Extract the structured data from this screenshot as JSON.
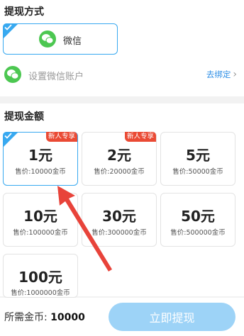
{
  "withdraw_method": {
    "title": "提现方式",
    "selected_option": {
      "label": "微信",
      "icon": "wechat-icon"
    },
    "setup_label": "设置微信账户",
    "bind_link": "去绑定"
  },
  "withdraw_amount": {
    "title": "提现金额",
    "options": [
      {
        "amount": "1元",
        "price": "售价:10000金币",
        "badge": "新人专享",
        "selected": true
      },
      {
        "amount": "2元",
        "price": "售价:20000金币",
        "badge": "新人专享",
        "selected": false
      },
      {
        "amount": "5元",
        "price": "售价:50000金币",
        "badge": "",
        "selected": false
      },
      {
        "amount": "10元",
        "price": "售价:100000金币",
        "badge": "",
        "selected": false
      },
      {
        "amount": "30元",
        "price": "售价:300000金币",
        "badge": "",
        "selected": false
      },
      {
        "amount": "50元",
        "price": "售价:500000金币",
        "badge": "",
        "selected": false
      },
      {
        "amount": "100元",
        "price": "售价:1000000金币",
        "badge": "",
        "selected": false
      }
    ]
  },
  "footer": {
    "required_label": "所需金币:",
    "required_value": "10000",
    "submit_label": "立即提现"
  },
  "colors": {
    "accent": "#38a9f0",
    "badge": "#ea4a34",
    "wechat_green": "#4cc751",
    "annotation_arrow": "#e8433a"
  }
}
